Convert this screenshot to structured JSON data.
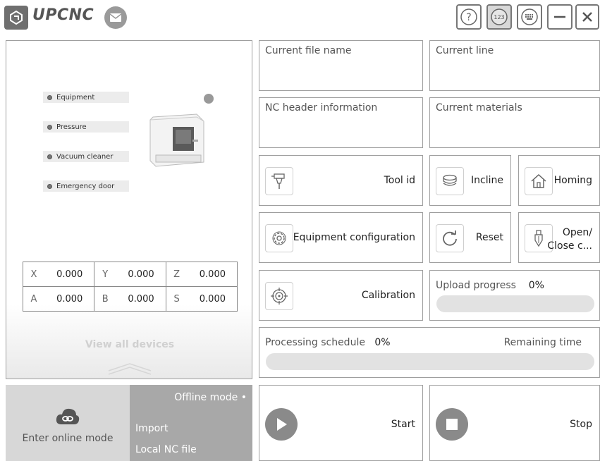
{
  "header": {
    "app_name": "UPCNC",
    "buttons": [
      "help",
      "numpad",
      "keyboard",
      "minimize",
      "close"
    ]
  },
  "devices": {
    "statuses": [
      "Equipment",
      "Pressure",
      "Vacuum cleaner",
      "Emergency door"
    ],
    "coords": {
      "x_label": "X",
      "x_val": "0.000",
      "y_label": "Y",
      "y_val": "0.000",
      "z_label": "Z",
      "z_val": "0.000",
      "a_label": "A",
      "a_val": "0.000",
      "b_label": "B",
      "b_val": "0.000",
      "s_label": "S",
      "s_val": "0.000"
    },
    "view_all": "View all devices"
  },
  "mode": {
    "online_label": "Enter online mode",
    "offline_label": "Offline mode •",
    "import_label": "Import",
    "local_label": "Local NC file"
  },
  "info": {
    "current_file": "Current file name",
    "current_line": "Current line",
    "nc_header": "NC header information",
    "current_materials": "Current materials"
  },
  "actions": {
    "tool_id": "Tool id",
    "incline": "Incline",
    "homing": "Homing",
    "equipment_config": "Equipment configuration",
    "reset": "Reset",
    "open_close_line1": "Open/",
    "open_close_line2": "Close c...",
    "calibration": "Calibration",
    "start": "Start",
    "stop": "Stop"
  },
  "upload": {
    "label": "Upload progress",
    "percent": "0%",
    "progress": 0
  },
  "processing": {
    "label": "Processing schedule",
    "percent": "0%",
    "remaining": "Remaining time",
    "progress": 0
  }
}
